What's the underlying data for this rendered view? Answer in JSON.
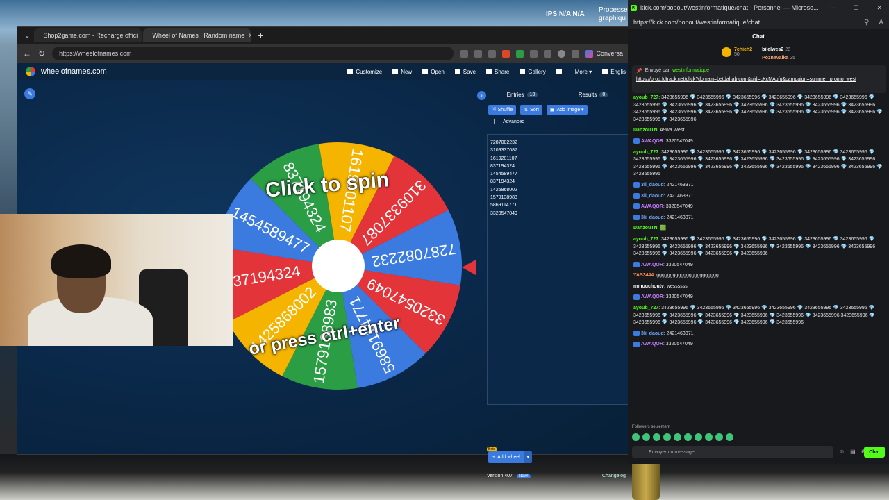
{
  "desktop": {
    "ips_label": "IPS  N/A  N/A",
    "proc_label": "Processe\ngraphiqu"
  },
  "browser": {
    "tabs": [
      {
        "label": "Shop2game.com - Recharge offici",
        "color": "#e04a4a"
      },
      {
        "label": "Wheel of Names | Random name",
        "color": "#3b7be0"
      }
    ],
    "new_tab": "+",
    "url": "https://wheelofnames.com",
    "conversation_label": "Conversa"
  },
  "app": {
    "logo_text": "wheelofnames.com",
    "menu": [
      {
        "label": "Customize",
        "icon": "palette-icon"
      },
      {
        "label": "New",
        "icon": "file-icon"
      },
      {
        "label": "Open",
        "icon": "folder-icon"
      },
      {
        "label": "Save",
        "icon": "save-icon"
      },
      {
        "label": "Share",
        "icon": "share-icon"
      },
      {
        "label": "Gallery",
        "icon": "search-icon"
      },
      {
        "label": "",
        "icon": "fullscreen-icon"
      },
      {
        "label": "More ▾",
        "icon": ""
      },
      {
        "label": "Englis",
        "icon": "globe-icon"
      }
    ],
    "wheel": {
      "top_text": "Click to spin",
      "bottom_text": "or press ctrl+enter",
      "segments": [
        {
          "label": "1619201107",
          "color": "#f4b400"
        },
        {
          "label": "3109337087",
          "color": "#e3343a"
        },
        {
          "label": "7287082232",
          "color": "#3b7be0"
        },
        {
          "label": "3320547049",
          "color": "#e3343a"
        },
        {
          "label": "5869114771",
          "color": "#3b7be0"
        },
        {
          "label": "1579138983",
          "color": "#2a9d45"
        },
        {
          "label": "1425868002",
          "color": "#f4b400"
        },
        {
          "label": "837194324",
          "color": "#e3343a"
        },
        {
          "label": "1454589477",
          "color": "#3b7be0"
        },
        {
          "label": "837194324",
          "color": "#2a9d45"
        }
      ]
    },
    "panel": {
      "entries_tab": "Entries",
      "entries_count": "10",
      "results_tab": "Results",
      "results_count": "0",
      "shuffle": "Shuffle",
      "sort": "Sort",
      "add_image": "Add image ▾",
      "advanced": "Advanced",
      "entries": [
        "7287082232",
        "3109337087",
        "1619201107",
        "837194324",
        "1454589477",
        "837194324",
        "1425868002",
        "1579138983",
        "5869114771",
        "3320547049"
      ],
      "add_wheel": "Add wheel",
      "bots_badge": "Bots",
      "version": "Version 407",
      "new_badge": "New!",
      "changelog": "Changelog"
    }
  },
  "kick": {
    "window_title": "kick.com/popout/westinformatique/chat - Personnel — Microso...",
    "url": "https://kick.com/popout/westinformatique/chat",
    "header": "Chat",
    "top": [
      {
        "name": "7chich2",
        "value": "50"
      },
      {
        "name": "bilelwes2",
        "value": "28"
      },
      {
        "name": "Poznavaika",
        "value": "25"
      }
    ],
    "pinned_by": "Envoyé par",
    "pinned_user": "westinformatique",
    "pinned_link": "https://prod.fdtrack.net/click?domain=betdahab.com&uid=cKcMAqfu&campaign=summer_promo_west",
    "messages": [
      {
        "user": "ayoub_727",
        "cls": "u-green",
        "text": "3423655996 💎 3423655996 💎 3423655996 💎 3423655996 💎 3423655996 💎 3423655996 💎 3423655996 💎 3423655996 💎 3423655996 💎 3423655996 💎 3423655996 💎 3423655996 💎 3423655996 3423655996 💎 3423655996 💎 3423655996 💎 3423655996 💎 3423655996 💎 3423655996 💎 3423655996 💎 3423655996 💎 3423655996"
      },
      {
        "user": "DanzouTN",
        "cls": "u-green",
        "text": "A9wa West"
      },
      {
        "user": "AWAQOR",
        "cls": "u-purple",
        "text": "3320547049"
      },
      {
        "user": "ayoub_727",
        "cls": "u-green",
        "text": "3423655996 💎 3423655996 💎 3423655996 💎 3423655996 💎 3423655996 💎 3423655996 💎 3423655996 💎 3423655996 💎 3423655996 💎 3423655996 💎 3423655996 💎 3423655996 💎 3423655996 3423655996 💎 3423655996 💎 3423655996 💎 3423655996 💎 3423655996 💎 3423655996 💎 3423655996 💎 3423655996"
      },
      {
        "user": "3li_daoud",
        "cls": "u-blue",
        "text": "2421463371"
      },
      {
        "user": "3li_daoud",
        "cls": "u-blue",
        "text": "2421463371"
      },
      {
        "user": "AWAQOR",
        "cls": "u-purple",
        "text": "3320547049"
      },
      {
        "user": "3li_daoud",
        "cls": "u-blue",
        "text": "2421463371"
      },
      {
        "user": "DanzouTN",
        "cls": "u-green",
        "text": "🟩"
      },
      {
        "user": "ayoub_727",
        "cls": "u-green",
        "text": "3423655996 💎 3423655996 💎 3423655996 💎 3423655996 💎 3423655996 💎 3423655996 💎 3423655996 💎 3423655996 💎 3423655996 💎 3423655996 💎 3423655996 💎 3423655996 💎 3423655996 3423655996 💎 3423655996 💎 3423655996 💎 3423655996"
      },
      {
        "user": "AWAQOR",
        "cls": "u-purple",
        "text": "3320547049"
      },
      {
        "user": "YAS3444",
        "cls": "u-orange",
        "text": "ggggggggggggggggggggggg"
      },
      {
        "user": "mmouchoutv",
        "cls": "u-white",
        "text": "wessssss"
      },
      {
        "user": "AWAQOR",
        "cls": "u-purple",
        "text": "3320547049"
      },
      {
        "user": "ayoub_727",
        "cls": "u-green",
        "text": "3423655996 💎 3423655996 💎 3423655996 💎 3423655996 💎 3423655996 💎 3423655996 💎 3423655996 💎 3423655996 💎 3423655996 💎 3423655996 💎 3423655996 💎 3423655996 3423655996 💎 3423655996 💎 3423655996 💎 3423655996 💎 3423655996 💎 3423655996"
      },
      {
        "user": "3li_daoud",
        "cls": "u-blue",
        "text": "2421463371"
      },
      {
        "user": "AWAQOR",
        "cls": "u-purple",
        "text": "3320547049"
      }
    ],
    "followers_only": "Followers seulement",
    "input_placeholder": "Envoyer un message",
    "chat_button": "Chat"
  }
}
